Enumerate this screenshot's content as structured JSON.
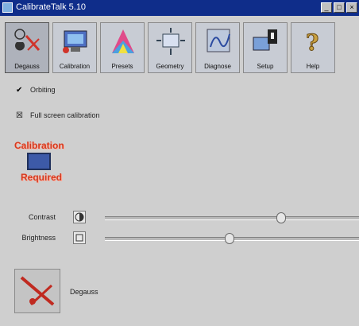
{
  "window": {
    "title": "CalibrateTalk 5.10"
  },
  "toolbar": {
    "items": [
      {
        "label": "Degauss",
        "icon": "degauss-icon"
      },
      {
        "label": "Calibration",
        "icon": "calibration-icon"
      },
      {
        "label": "Presets",
        "icon": "presets-icon"
      },
      {
        "label": "Geometry",
        "icon": "geometry-icon"
      },
      {
        "label": "Diagnose",
        "icon": "diagnose-icon"
      },
      {
        "label": "Setup",
        "icon": "setup-icon"
      },
      {
        "label": "Help",
        "icon": "help-icon"
      }
    ]
  },
  "options": {
    "orbiting": {
      "label": "Orbiting",
      "checked": true
    },
    "full_screen": {
      "label": "Full screen calibration",
      "checked": true
    }
  },
  "calibration": {
    "line1": "Calibration",
    "line2": "Required"
  },
  "sliders": {
    "contrast": {
      "label": "Contrast",
      "value_percent": 70
    },
    "brightness": {
      "label": "Brightness",
      "value_percent": 49
    }
  },
  "degauss": {
    "label": "Degauss"
  },
  "colors": {
    "titlebar": "#0f2d8a",
    "accent": "#d63a1e"
  }
}
